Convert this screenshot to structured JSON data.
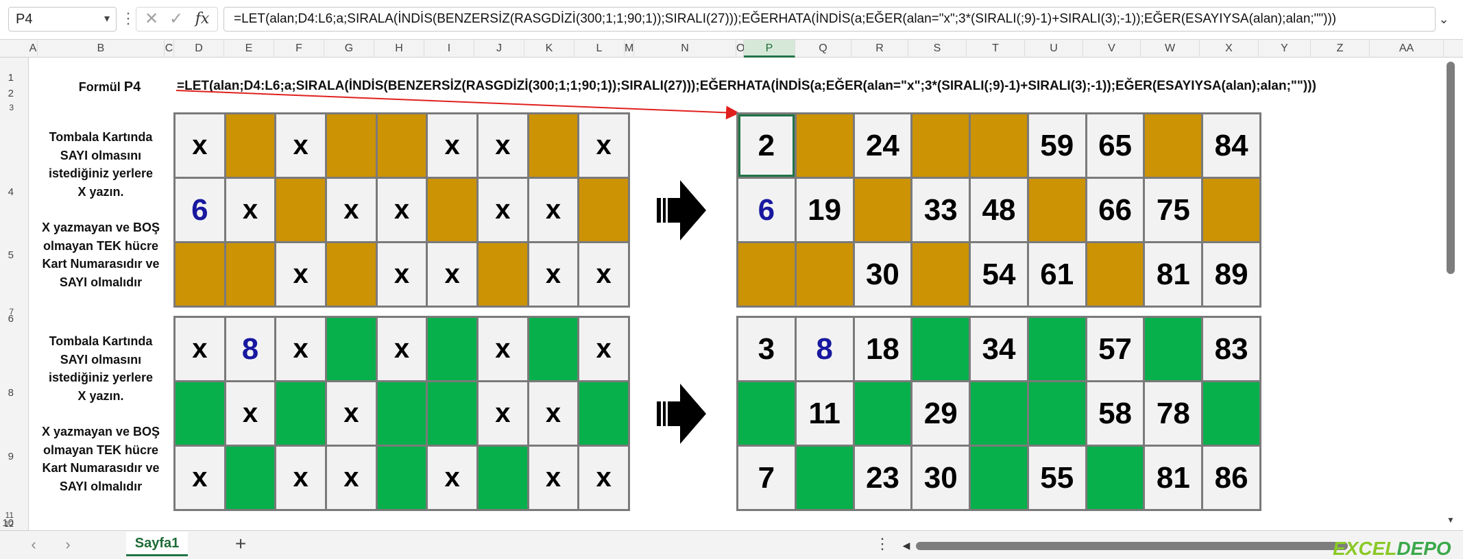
{
  "name_box": "P4",
  "formula_bar": {
    "fx": "fx",
    "cancel": "✕",
    "enter": "✓",
    "formula": "=LET(alan;D4:L6;a;SIRALA(İNDİS(BENZERSİZ(RASGDİZİ(300;1;1;90;1));SIRALI(27)));EĞERHATA(İNDİS(a;EĞER(alan=\"x\";3*(SIRALI(;9)-1)+SIRALI(3);-1));EĞER(ESAYIYSA(alan);alan;\"\")))"
  },
  "columns": [
    "A",
    "B",
    "C",
    "D",
    "E",
    "F",
    "G",
    "H",
    "I",
    "J",
    "K",
    "L",
    "M",
    "N",
    "O",
    "P",
    "Q",
    "R",
    "S",
    "T",
    "U",
    "V",
    "W",
    "X",
    "Y",
    "Z",
    "AA"
  ],
  "rows": [
    "1",
    "2",
    "3",
    "4",
    "5",
    "6",
    "7",
    "8",
    "9",
    "10",
    "11",
    "12"
  ],
  "formula_label": {
    "prefix": "Formül",
    "cell": "P4"
  },
  "formula_display": "=LET(alan;D4:L6;a;SIRALA(İNDİS(BENZERSİZ(RASGDİZİ(300;1;1;90;1));SIRALI(27)));EĞERHATA(İNDİS(a;EĞER(alan=\"x\";3*(SIRALI(;9)-1)+SIRALI(3);-1));EĞER(ESAYIYSA(alan);alan;\"\")))",
  "instructions": {
    "line1": "Tombala Kartında",
    "line2": "SAYI olmasını",
    "line3": "istediğiniz yerlere",
    "line4": "X  yazın.",
    "line5": "X yazmayan ve BOŞ",
    "line6": "olmayan TEK hücre",
    "line7": "Kart Numarasıdır ve",
    "line8": "SAYI olmalıdır"
  },
  "cards": [
    {
      "color": "#cc9304",
      "input": [
        [
          "x",
          "",
          "x",
          "",
          "",
          "x",
          "x",
          "",
          "x"
        ],
        [
          "6",
          "x",
          "",
          "x",
          "x",
          "",
          "x",
          "x",
          ""
        ],
        [
          "",
          "",
          "x",
          "",
          "x",
          "x",
          "",
          "x",
          "x"
        ]
      ],
      "output": [
        [
          "2",
          "",
          "24",
          "",
          "",
          "59",
          "65",
          "",
          "84"
        ],
        [
          "6",
          "19",
          "",
          "33",
          "48",
          "",
          "66",
          "75",
          ""
        ],
        [
          "",
          "",
          "30",
          "",
          "54",
          "61",
          "",
          "81",
          "89"
        ]
      ]
    },
    {
      "color": "#07b04b",
      "input": [
        [
          "x",
          "8",
          "x",
          "",
          "x",
          "",
          "x",
          "",
          "x"
        ],
        [
          "",
          "x",
          "",
          "x",
          "",
          "",
          "x",
          "x",
          ""
        ],
        [
          "x",
          "",
          "x",
          "x",
          "",
          "x",
          "",
          "x",
          "x"
        ]
      ],
      "output": [
        [
          "3",
          "8",
          "18",
          "",
          "34",
          "",
          "57",
          "",
          "83"
        ],
        [
          "",
          "11",
          "",
          "29",
          "",
          "",
          "58",
          "78",
          ""
        ],
        [
          "7",
          "",
          "23",
          "30",
          "",
          "55",
          "",
          "81",
          "86"
        ]
      ]
    }
  ],
  "sheet_tab": "Sayfa1",
  "add_sheet": "+",
  "watermark": {
    "a": "EXCEL",
    "b": "DEPO"
  }
}
